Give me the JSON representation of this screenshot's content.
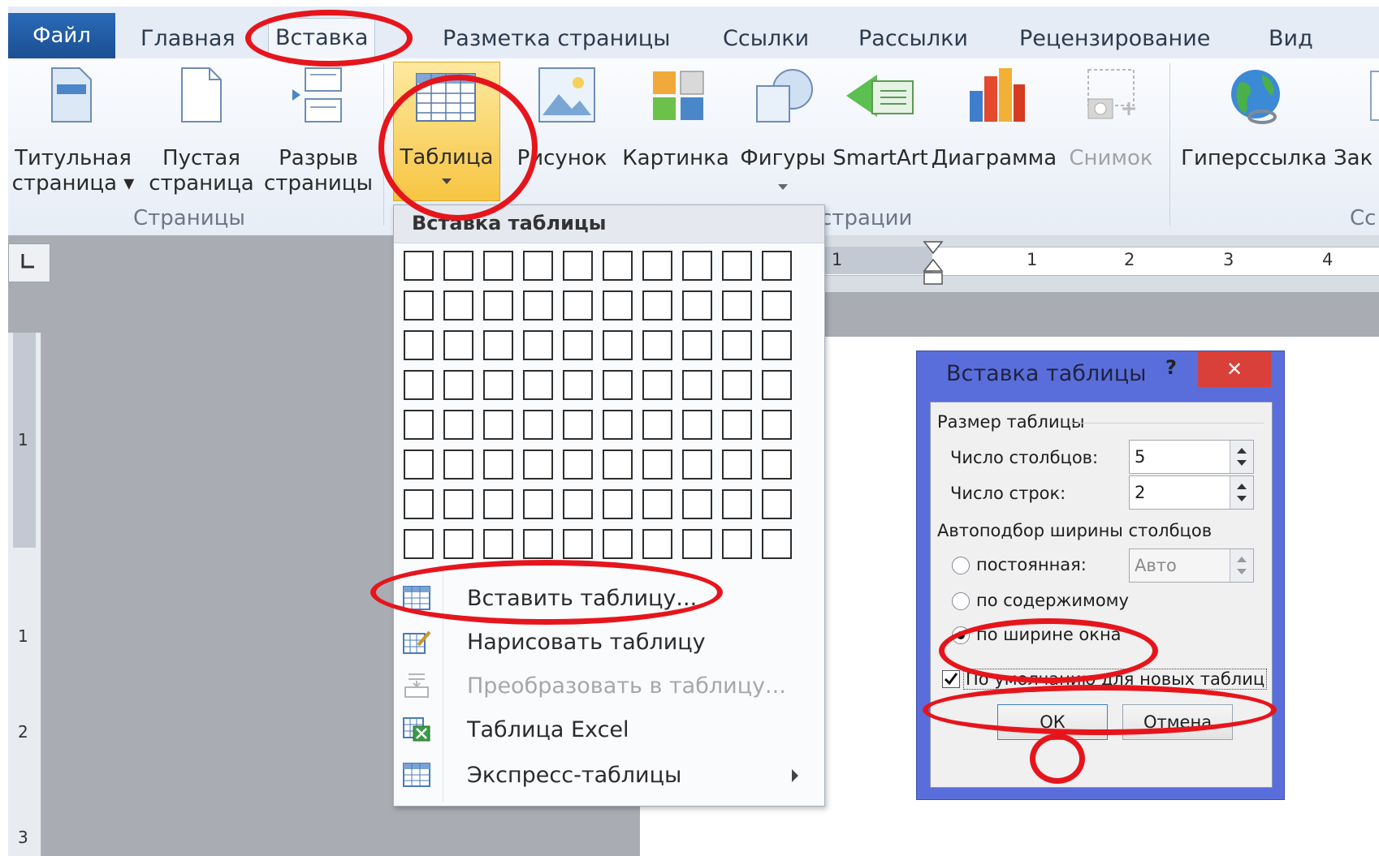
{
  "ribbon": {
    "tabs": [
      "Файл",
      "Главная",
      "Вставка",
      "Разметка страницы",
      "Ссылки",
      "Рассылки",
      "Рецензирование",
      "Вид"
    ],
    "active_tab": "Вставка",
    "buttons": {
      "title_page": [
        "Титульная",
        "страница ▾"
      ],
      "blank_page": [
        "Пустая",
        "страница"
      ],
      "page_break": [
        "Разрыв",
        "страницы"
      ],
      "table": "Таблица",
      "picture": "Рисунок",
      "clipart": "Картинка",
      "shapes": "Фигуры",
      "smartart": "SmartArt",
      "chart": "Диаграмма",
      "screenshot": "Снимок",
      "hyperlink": "Гиперссылка",
      "bookmark": "Зак"
    },
    "groups": {
      "pages": "Страницы",
      "illustrations": "страции",
      "links": "Сс"
    }
  },
  "ruler": {
    "h_labels": [
      "1",
      "1",
      "2",
      "3",
      "4"
    ],
    "v_labels": [
      "1",
      "1",
      "2",
      "3"
    ]
  },
  "dropdown": {
    "header": "Вставка таблицы",
    "grid": {
      "columns": 10,
      "rows": 8
    },
    "items": [
      {
        "label": "Вставить таблицу...",
        "enabled": true,
        "icon": "table-icon"
      },
      {
        "label": "Нарисовать таблицу",
        "enabled": true,
        "icon": "draw-table-icon"
      },
      {
        "label": "Преобразовать в таблицу...",
        "enabled": false,
        "icon": "convert-table-icon"
      },
      {
        "label": "Таблица Excel",
        "enabled": true,
        "icon": "excel-icon"
      },
      {
        "label": "Экспресс-таблицы",
        "enabled": true,
        "icon": "quick-table-icon"
      }
    ]
  },
  "dialog": {
    "title": "Вставка таблицы",
    "help": "?",
    "close": "✕",
    "size_section": "Размер таблицы",
    "columns_label": "Число столбцов:",
    "columns_value": "5",
    "rows_label": "Число строк:",
    "rows_value": "2",
    "autofit_section": "Автоподбор ширины столбцов",
    "fixed_label": "постоянная:",
    "fixed_value": "Авто",
    "content_label": "по содержимому",
    "window_label": "по ширине окна",
    "selected_option": "по ширине окна",
    "default_label": "По умолчанию для новых таблиц",
    "default_checked": true,
    "ok": "ОК",
    "cancel": "Отмена"
  },
  "colors": {
    "highlight": "#e6151c",
    "file_tab": "#2a6ab8",
    "dialog_frame": "#5a6edb"
  }
}
